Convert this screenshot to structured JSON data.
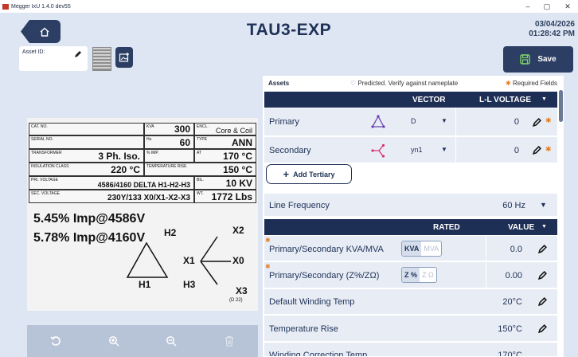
{
  "window": {
    "title": "Megger IxU 1.4.0 dev55",
    "minimize": "–",
    "maximize": "▢",
    "close": "✕"
  },
  "header": {
    "title": "TAU3-EXP",
    "date": "03/04/2026",
    "time": "01:28:42 PM"
  },
  "asset": {
    "label": "Asset ID:"
  },
  "save": {
    "label": "Save"
  },
  "nameplate": {
    "cat_no": "CAT. NO.",
    "kva_lab": "KVA",
    "kva": "300",
    "encl_lab": "ENCL.",
    "encl": "Core & Coil",
    "serial_no": "SERIAL NO.",
    "hz_lab": "Hz.",
    "hz": "60",
    "type_lab": "TYPE",
    "type": "ANN",
    "transformer_lab": "TRANSFORMER",
    "transformer": "3 Ph. Iso.",
    "imp_lab": "% IMP.",
    "at_lab": "AT",
    "at": "170 °C",
    "ins_lab": "INSULATION CLASS",
    "ins": "220 °C",
    "temp_lab": "TEMPERATURE RISE",
    "temp": "150 °C",
    "pri_lab": "PRI. VOLTAGE",
    "pri": "4586/4160 DELTA H1-H2-H3",
    "bil_lab": "BIL.",
    "bil": "10 KV",
    "sec_lab": "SEC. VOLTAGE",
    "sec": "230Y/133 X0/X1-X2-X3",
    "wt_lab": "WT.",
    "wt": "1772 Lbs",
    "imp1": "5.45% Imp@4586V",
    "imp2": "5.78% Imp@4160V",
    "h1": "H1",
    "h2": "H2",
    "h3": "H3",
    "x0": "X0",
    "x1": "X1",
    "x2": "X2",
    "x3": "X3",
    "code": "(D 22)"
  },
  "panel": {
    "assets": "Assets",
    "predicted": "Predicted. Verify against nameplate",
    "required": "Required Fields",
    "vector_header": "VECTOR",
    "llv_header": "L-L VOLTAGE",
    "primary": {
      "label": "Primary",
      "vector": "D",
      "voltage": "0"
    },
    "secondary": {
      "label": "Secondary",
      "vector": "yn1",
      "voltage": "0"
    },
    "add_tertiary": "Add Tertiary",
    "line_freq": {
      "label": "Line Frequency",
      "value": "60 Hz"
    },
    "rated_header": "RATED",
    "value_header": "VALUE",
    "kva": {
      "label": "Primary/Secondary KVA/MVA",
      "opt_on": "KVA",
      "opt_off": "MVA",
      "value": "0.0"
    },
    "imp": {
      "label": "Primary/Secondary (Z%/ZΩ)",
      "opt_on": "Z %",
      "opt_off": "Z Ω",
      "value": "0.00"
    },
    "wind_temp": {
      "label": "Default Winding Temp",
      "value": "20°C"
    },
    "temp_rise": {
      "label": "Temperature Rise",
      "value": "150°C"
    },
    "next_row": {
      "label": "Winding Correction Temp",
      "value": "170°C"
    }
  },
  "colors": {
    "navy": "#1e2f55",
    "accent": "#e67e22",
    "save_icon": "#7fd36b"
  }
}
